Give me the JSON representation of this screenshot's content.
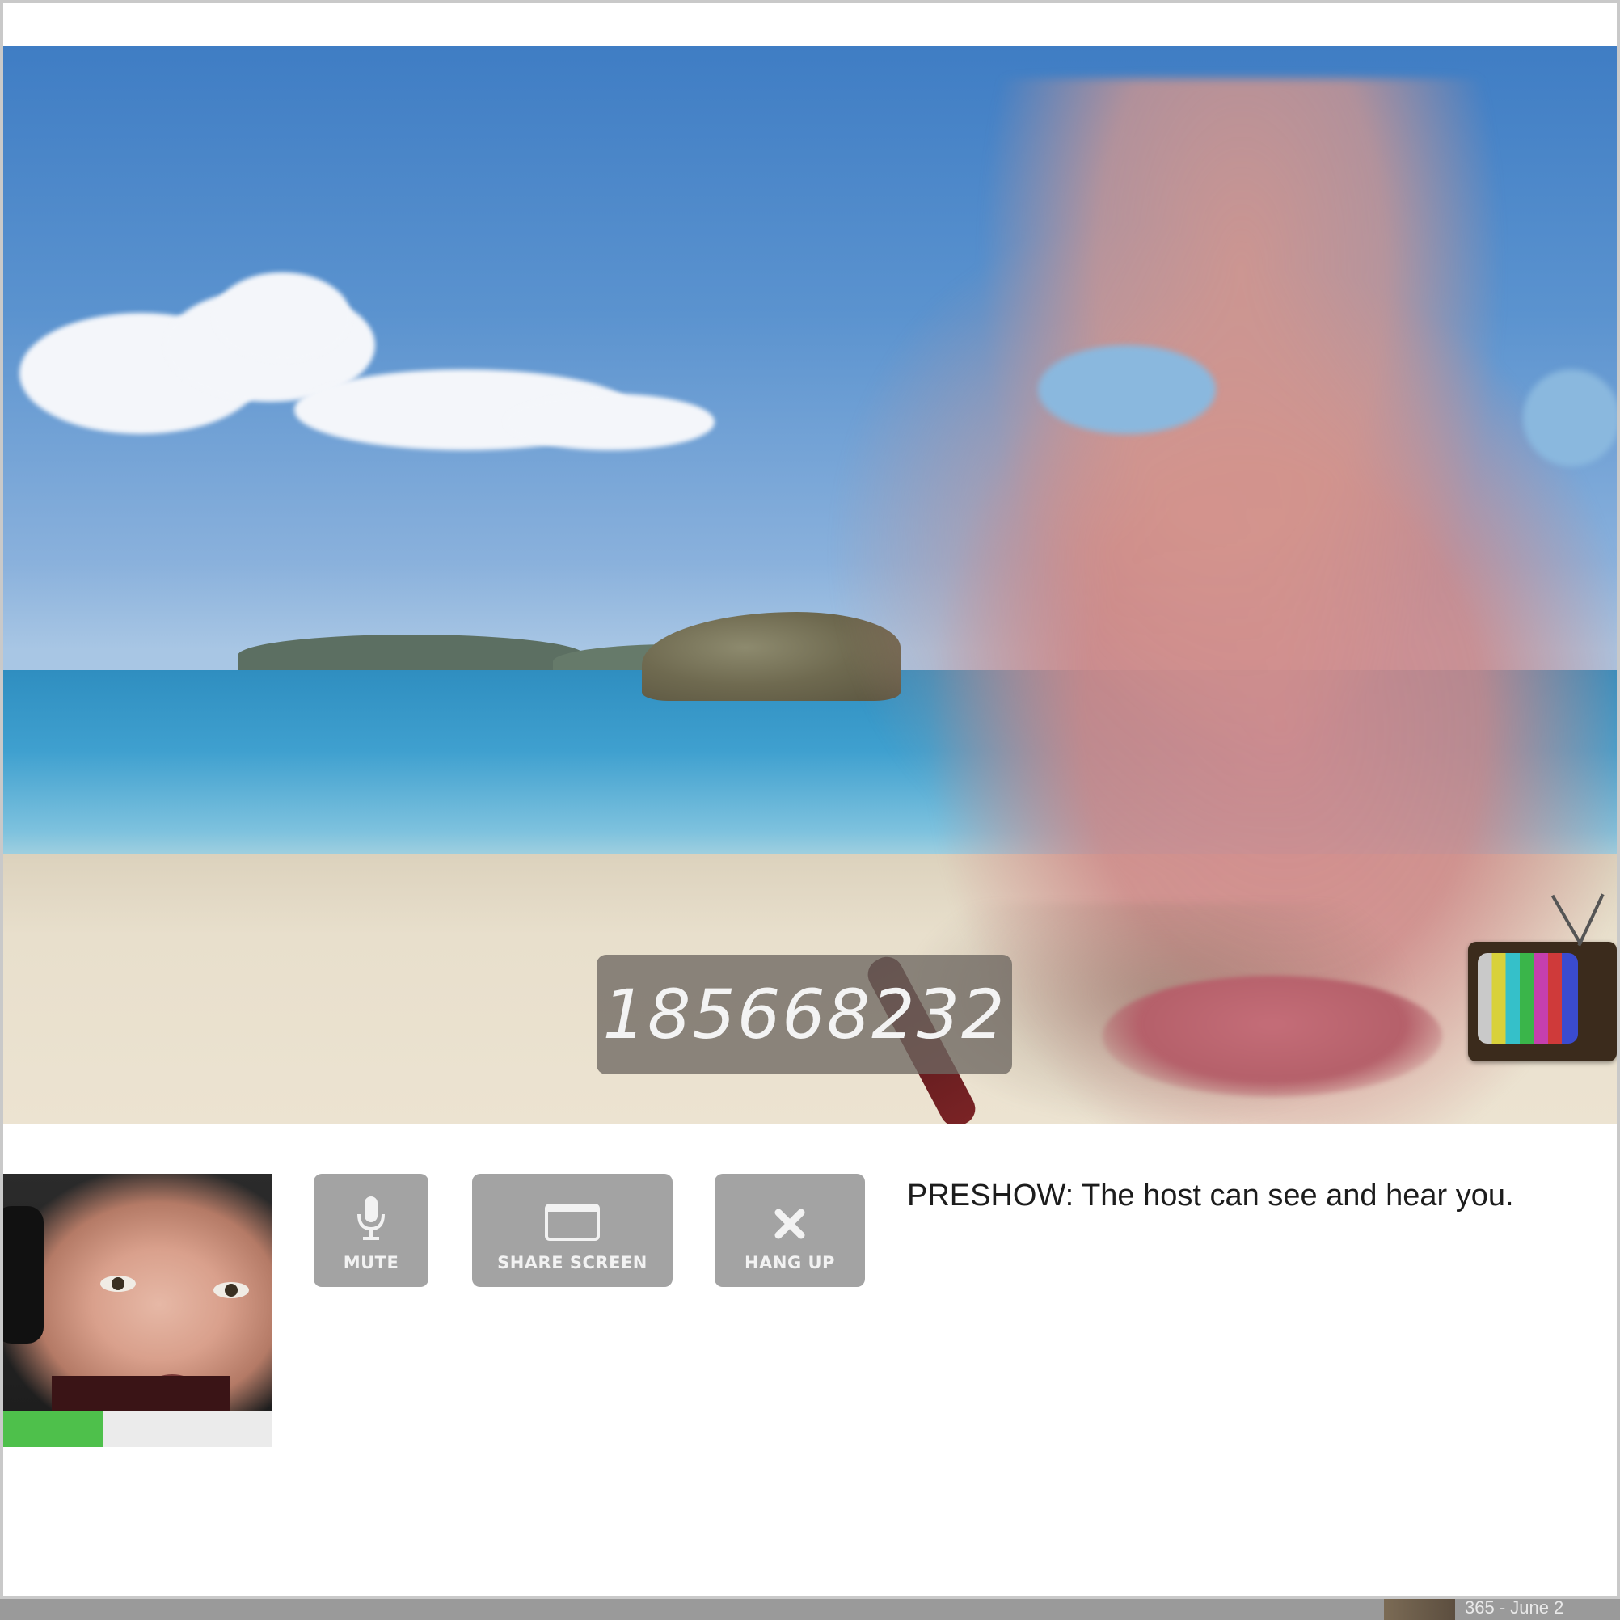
{
  "main_video": {
    "room_code": "185668232"
  },
  "controls": {
    "mute_label": "MUTE",
    "share_screen_label": "SHARE SCREEN",
    "hang_up_label": "HANG UP"
  },
  "self_view": {
    "audio_level_percent": 37
  },
  "status": {
    "message": "PRESHOW: The host can see and hear you."
  },
  "taskbar": {
    "item_label": "365 - June 2"
  },
  "colors": {
    "button_bg": "#a3a3a3",
    "level_green": "#4ec04b",
    "code_box_bg": "#6e6862"
  }
}
